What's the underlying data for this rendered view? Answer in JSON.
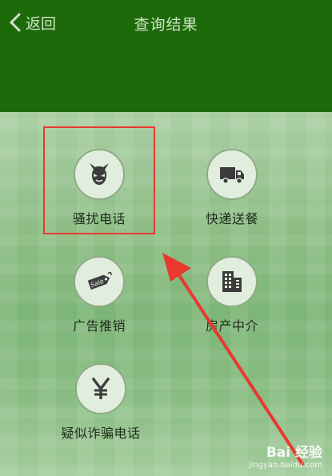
{
  "header": {
    "back_label": "返回",
    "title": "查询结果"
  },
  "categories": [
    {
      "label": "骚扰电话",
      "icon": "devil-icon"
    },
    {
      "label": "快递送餐",
      "icon": "delivery-truck-icon"
    },
    {
      "label": "广告推销",
      "icon": "sale-tag-icon"
    },
    {
      "label": "房产中介",
      "icon": "building-icon"
    },
    {
      "label": "疑似诈骗电话",
      "icon": "yen-icon"
    }
  ],
  "watermark": {
    "brand": "Bai 经验",
    "url": "jingyan.baidu.com"
  },
  "colors": {
    "header": "#1d6a0b",
    "highlight": "#e8392f",
    "icon": "#3c3c3c"
  }
}
